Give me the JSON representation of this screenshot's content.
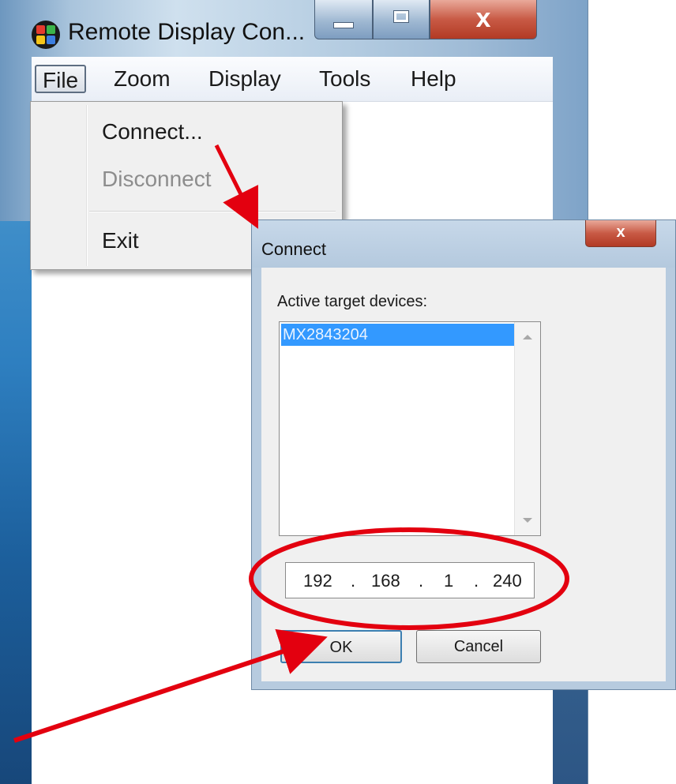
{
  "window": {
    "title": "Remote Display Con...",
    "close_glyph": "x",
    "icon": "remote-display-app-icon"
  },
  "menubar": {
    "items": [
      "File",
      "Zoom",
      "Display",
      "Tools",
      "Help"
    ],
    "active": "File"
  },
  "file_menu": {
    "items": [
      {
        "label": "Connect...",
        "enabled": true
      },
      {
        "label": "Disconnect",
        "enabled": false
      },
      {
        "label": "Exit",
        "enabled": true
      }
    ]
  },
  "dialog": {
    "title": "Connect",
    "close_glyph": "x",
    "list_label": "Active target devices:",
    "devices": [
      "MX2843204"
    ],
    "selected_device": "MX2843204",
    "ip": {
      "o1": "192",
      "o2": "168",
      "o3": "1",
      "o4": "240"
    },
    "ok_label": "OK",
    "cancel_label": "Cancel"
  },
  "colors": {
    "annotation": "#e3000f",
    "selection": "#3399ff",
    "close_button": "#c85a45"
  }
}
